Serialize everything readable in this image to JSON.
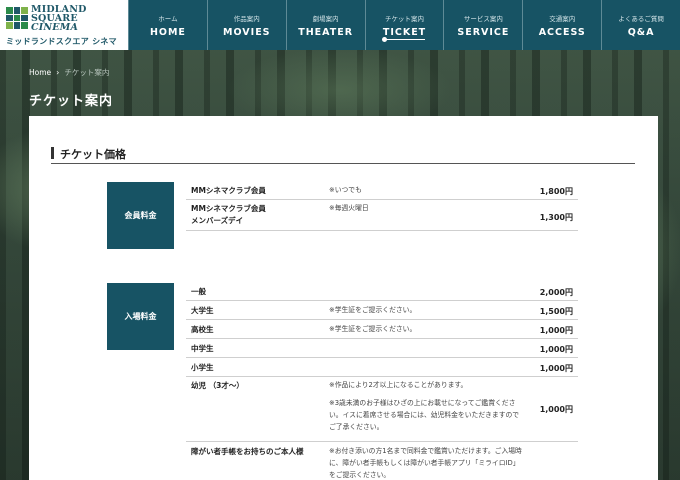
{
  "logo": {
    "line1": "MIDLAND",
    "line2": "SQUARE",
    "line3": "CINEMA",
    "jp": "ミッドランドスクエア シネマ",
    "colors": [
      "#2b8b4a",
      "#1f5868",
      "#7fb24a",
      "#1f5868",
      "#2b8b4a",
      "#1f5868",
      "#7fb24a",
      "#1f5868",
      "#2b8b4a"
    ]
  },
  "nav": [
    {
      "jp": "ホーム",
      "en": "HOME"
    },
    {
      "jp": "作品案内",
      "en": "MOVIES"
    },
    {
      "jp": "劇場案内",
      "en": "THEATER"
    },
    {
      "jp": "チケット案内",
      "en": "TICKET"
    },
    {
      "jp": "サービス案内",
      "en": "SERVICE"
    },
    {
      "jp": "交通案内",
      "en": "ACCESS"
    },
    {
      "jp": "よくあるご質問",
      "en": "Q&A"
    }
  ],
  "breadcrumb": {
    "home": "Home",
    "sep": "›",
    "current": "チケット案内"
  },
  "page_title": "チケット案内",
  "section_title": "チケット価格",
  "member": {
    "label": "会員料金",
    "rows": [
      {
        "name": "MMシネマクラブ会員",
        "note": "※いつでも",
        "price": "1,800円"
      },
      {
        "name": "MMシネマクラブ会員\nメンバーズデイ",
        "name1": "MMシネマクラブ会員",
        "name2": "メンバーズデイ",
        "note": "※毎週火曜日",
        "price": "1,300円"
      }
    ]
  },
  "admission": {
    "label": "入場料金",
    "rows": [
      {
        "name": "一般",
        "note": "",
        "price": "2,000円"
      },
      {
        "name": "大学生",
        "note": "※学生証をご提示ください。",
        "price": "1,500円"
      },
      {
        "name": "高校生",
        "note": "※学生証をご提示ください。",
        "price": "1,000円"
      },
      {
        "name": "中学生",
        "note": "",
        "price": "1,000円"
      },
      {
        "name": "小学生",
        "note": "",
        "price": "1,000円"
      },
      {
        "name": "幼児 （3才～）",
        "note1": "※作品により2才以上になることがあります。",
        "note2": "※3歳未満のお子様はひざの上にお載せになってご鑑賞ください。イスに着席させる場合には、幼児料金をいただきますのでご了承ください。",
        "price": "1,000円"
      },
      {
        "name": "障がい者手帳をお持ちのご本人様",
        "note": "※お付き添いの方1名まで同料金で鑑賞いただけます。ご入場時に、障がい者手帳もしくは障がい者手帳アプリ「ミライロID」をご提示ください。",
        "price": ""
      }
    ]
  }
}
